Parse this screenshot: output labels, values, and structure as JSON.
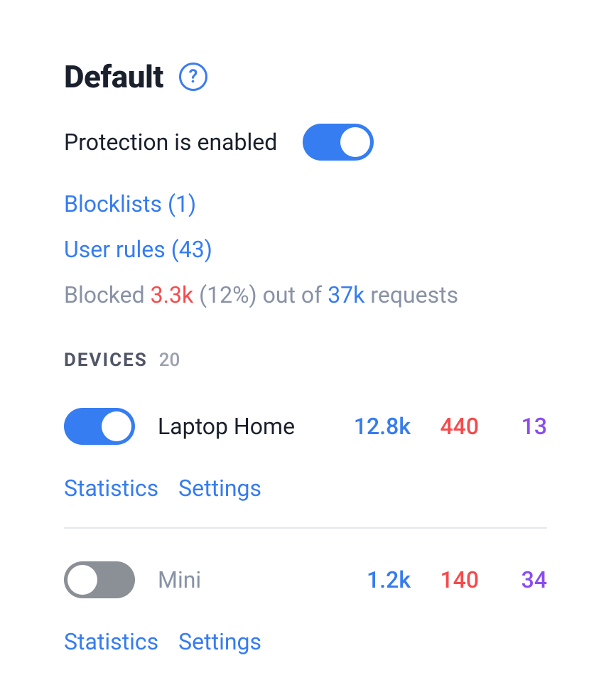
{
  "title": "Default",
  "help_icon_char": "?",
  "protection": {
    "label": "Protection is enabled",
    "enabled": true
  },
  "blocklists": {
    "label": "Blocklists",
    "count": "1"
  },
  "user_rules": {
    "label": "User rules",
    "count": "43"
  },
  "blocked_stats": {
    "prefix": "Blocked ",
    "blocked_count": "3.3k",
    "percent_text": " (12%) out of ",
    "total": "37k",
    "suffix": " requests"
  },
  "devices_section": {
    "label": "DEVICES",
    "count": "20"
  },
  "devices": [
    {
      "enabled": true,
      "name": "Laptop Home",
      "stat_requests": "12.8k",
      "stat_blocked": "440",
      "stat_other": "13",
      "link_statistics": "Statistics",
      "link_settings": "Settings"
    },
    {
      "enabled": false,
      "name": "Mini",
      "stat_requests": "1.2k",
      "stat_blocked": "140",
      "stat_other": "34",
      "link_statistics": "Statistics",
      "link_settings": "Settings"
    }
  ]
}
